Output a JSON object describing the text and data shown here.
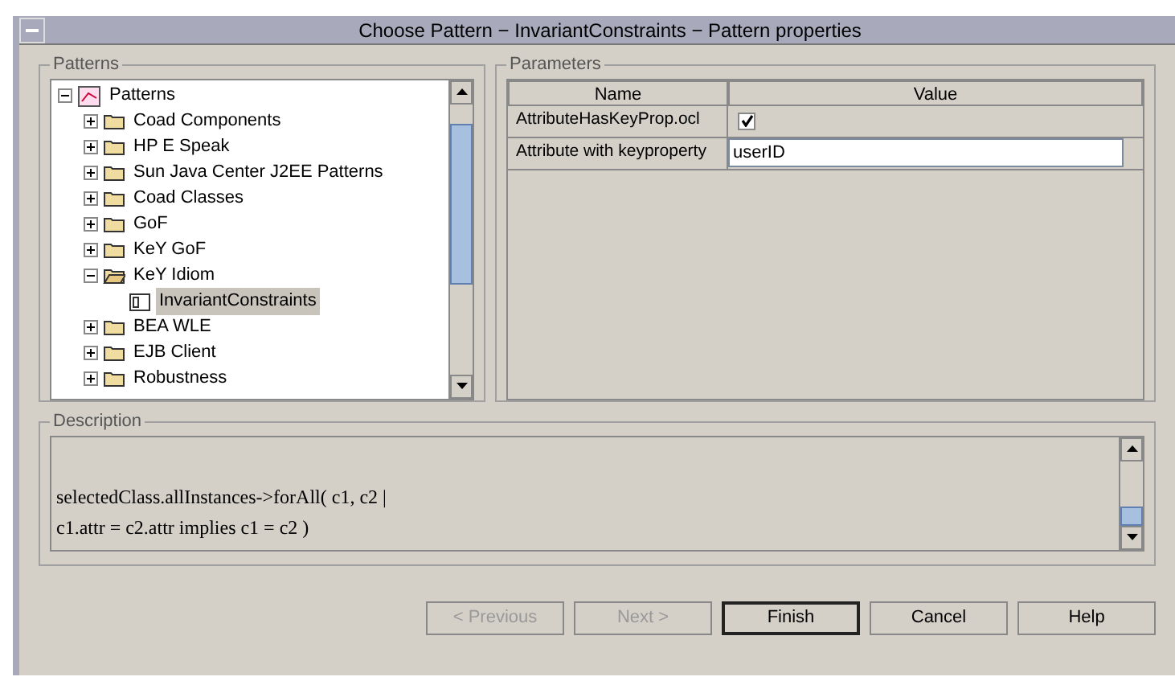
{
  "window": {
    "title": "Choose Pattern − InvariantConstraints − Pattern properties"
  },
  "patterns": {
    "title": "Patterns",
    "tree": [
      {
        "label": "Patterns",
        "kind": "root",
        "expanded": true,
        "selected": false,
        "children": [
          {
            "label": "Coad Components",
            "kind": "folder",
            "expanded": false,
            "selected": false
          },
          {
            "label": "HP E Speak",
            "kind": "folder",
            "expanded": false,
            "selected": false
          },
          {
            "label": "Sun Java Center J2EE Patterns",
            "kind": "folder",
            "expanded": false,
            "selected": false
          },
          {
            "label": "Coad Classes",
            "kind": "folder",
            "expanded": false,
            "selected": false
          },
          {
            "label": "GoF",
            "kind": "folder",
            "expanded": false,
            "selected": false
          },
          {
            "label": "KeY GoF",
            "kind": "folder",
            "expanded": false,
            "selected": false
          },
          {
            "label": "KeY Idiom",
            "kind": "folder",
            "expanded": true,
            "selected": false,
            "children": [
              {
                "label": "InvariantConstraints",
                "kind": "pattern",
                "selected": true
              }
            ]
          },
          {
            "label": "BEA WLE",
            "kind": "folder",
            "expanded": false,
            "selected": false
          },
          {
            "label": "EJB Client",
            "kind": "folder",
            "expanded": false,
            "selected": false
          },
          {
            "label": "Robustness",
            "kind": "folder",
            "expanded": false,
            "selected": false
          }
        ]
      }
    ]
  },
  "parameters": {
    "title": "Parameters",
    "columns": [
      "Name",
      "Value"
    ],
    "rows": [
      {
        "name": "AttributeHasKeyProp.ocl",
        "kind": "checkbox",
        "checked": true
      },
      {
        "name": "Attribute with keyproperty",
        "kind": "text",
        "value": "userID"
      }
    ]
  },
  "description": {
    "title": "Description",
    "lines": [
      "selectedClass.allInstances->forAll( c1, c2 |",
      "c1.attr = c2.attr implies c1 = c2 )"
    ]
  },
  "buttons": [
    {
      "label": "< Previous",
      "disabled": true,
      "default": false
    },
    {
      "label": "Next >",
      "disabled": true,
      "default": false
    },
    {
      "label": "Finish",
      "disabled": false,
      "default": true
    },
    {
      "label": "Cancel",
      "disabled": false,
      "default": false
    },
    {
      "label": "Help",
      "disabled": false,
      "default": false
    }
  ]
}
